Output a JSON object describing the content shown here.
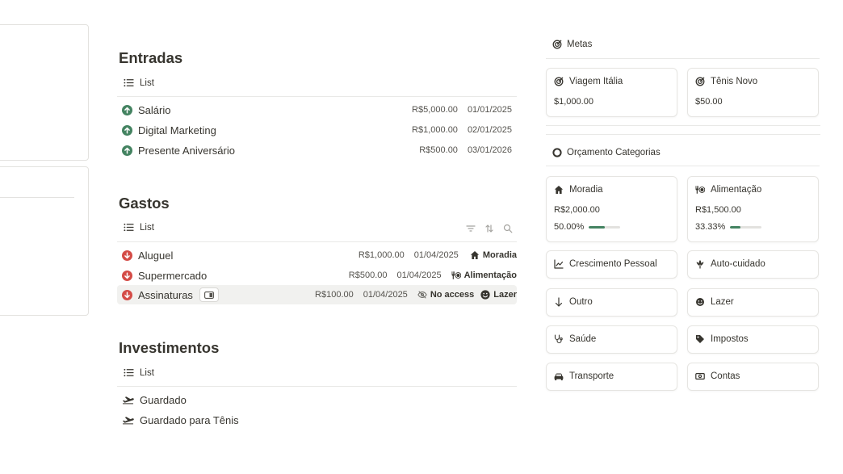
{
  "colors": {
    "income": "#448361",
    "expense": "#d44c47",
    "accent": "#448361"
  },
  "entradas": {
    "title": "Entradas",
    "view_label": "List",
    "rows": [
      {
        "name": "Salário",
        "value": "R$5,000.00",
        "date": "01/01/2025",
        "icon": "arrow-up-circle-icon"
      },
      {
        "name": "Digital Marketing",
        "value": "R$1,000.00",
        "date": "02/01/2025",
        "icon": "arrow-up-circle-icon"
      },
      {
        "name": "Presente Aniversário",
        "value": "R$500.00",
        "date": "03/01/2026",
        "icon": "arrow-up-circle-icon"
      }
    ]
  },
  "gastos": {
    "title": "Gastos",
    "view_label": "List",
    "rows": [
      {
        "name": "Aluguel",
        "value": "R$1,000.00",
        "date": "01/04/2025",
        "category": "Moradia",
        "icon": "arrow-down-circle-icon"
      },
      {
        "name": "Supermercado",
        "value": "R$500.00",
        "date": "01/04/2025",
        "category": "Alimentação",
        "icon": "arrow-down-circle-icon"
      },
      {
        "name": "Assinaturas",
        "value": "R$100.00",
        "date": "01/04/2025",
        "access": "No access",
        "category": "Lazer",
        "icon": "arrow-down-circle-icon"
      }
    ]
  },
  "investimentos": {
    "title": "Investimentos",
    "view_label": "List",
    "rows": [
      {
        "name": "Guardado",
        "icon": "plane-takeoff-icon"
      },
      {
        "name": "Guardado para Tênis",
        "icon": "plane-takeoff-icon"
      }
    ]
  },
  "metas": {
    "title": "Metas",
    "cards": [
      {
        "title": "Viagem Itália",
        "value": "$1,000.00",
        "icon": "target-icon"
      },
      {
        "title": "Tênis Novo",
        "value": "$50.00",
        "icon": "target-icon"
      }
    ]
  },
  "orcamento": {
    "title": "Orçamento Categorias",
    "cards": [
      {
        "title": "Moradia",
        "value": "R$2,000.00",
        "percent": "50.00%",
        "progress": 0.5,
        "icon": "house-icon"
      },
      {
        "title": "Alimentação",
        "value": "R$1,500.00",
        "percent": "33.33%",
        "progress": 0.3333,
        "icon": "fork-knife-icon"
      }
    ],
    "small_cards": [
      {
        "title": "Crescimento Pessoal",
        "icon": "trend-chart-icon"
      },
      {
        "title": "Auto-cuidado",
        "icon": "lotus-icon"
      },
      {
        "title": "Outro",
        "icon": "arrow-down-icon"
      },
      {
        "title": "Lazer",
        "icon": "smiley-icon"
      },
      {
        "title": "Saúde",
        "icon": "stethoscope-icon"
      },
      {
        "title": "Impostos",
        "icon": "price-tag-icon"
      },
      {
        "title": "Transporte",
        "icon": "car-icon"
      },
      {
        "title": "Contas",
        "icon": "cash-icon"
      }
    ]
  }
}
